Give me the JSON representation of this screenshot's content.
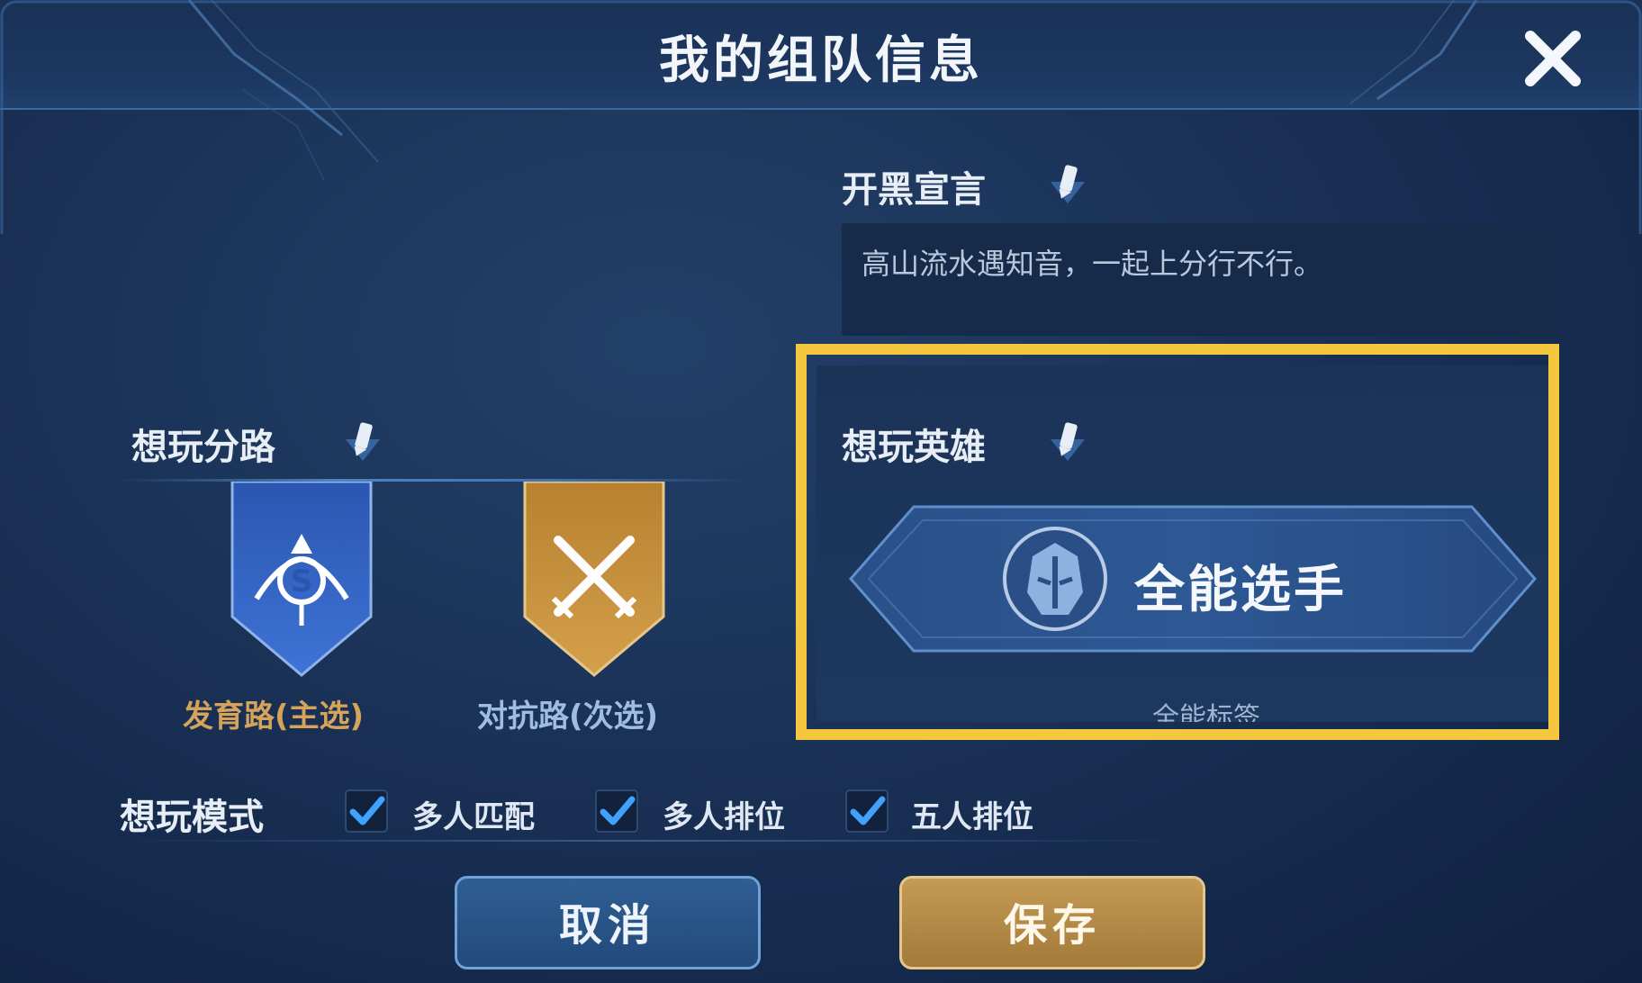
{
  "header": {
    "title": "我的组队信息"
  },
  "declaration": {
    "label": "开黑宣言",
    "text": "高山流水遇知音，一起上分行不行。"
  },
  "lanes": {
    "label": "想玩分路",
    "primary": {
      "label": "发育路(主选)",
      "color": "#d6a35a"
    },
    "secondary": {
      "label": "对抗路(次选)",
      "color": "#9fbde0"
    }
  },
  "hero": {
    "label": "想玩英雄",
    "name": "全能选手",
    "subtitle": "全能标签"
  },
  "modes": {
    "label": "想玩模式",
    "items": [
      {
        "label": "多人匹配",
        "checked": true
      },
      {
        "label": "多人排位",
        "checked": true
      },
      {
        "label": "五人排位",
        "checked": true
      }
    ]
  },
  "buttons": {
    "cancel": "取消",
    "save": "保存"
  },
  "colors": {
    "highlight": "#f5c73e",
    "accent_blue": "#3d6fb0",
    "accent_gold": "#c49a55"
  }
}
